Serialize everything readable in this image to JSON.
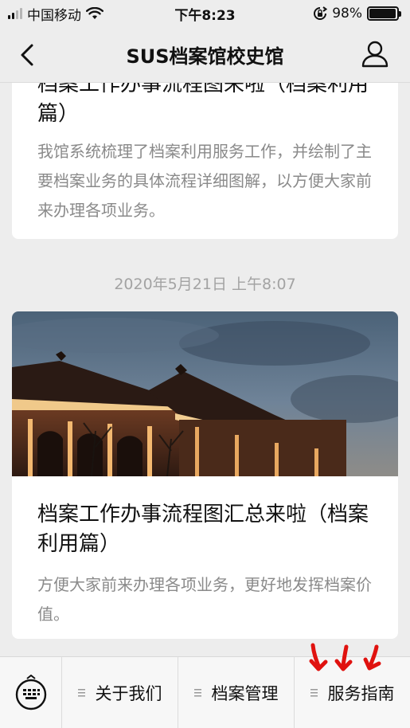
{
  "status_bar": {
    "carrier": "中国移动",
    "time": "下午8:23",
    "battery": "98%",
    "battery_level": 0.98
  },
  "nav": {
    "title": "SUS档案馆校史馆"
  },
  "feed": {
    "article1": {
      "title": "档案工作办事流程图来啦（档案利用篇）",
      "description": "我馆系统梳理了档案利用服务工作，并绘制了主要档案业务的具体流程详细图解，以方便大家前来办理各项业务。"
    },
    "timestamp": "2020年5月21日 上午8:07",
    "article2": {
      "title": "档案工作办事流程图汇总来啦（档案利用篇）",
      "description": "方便大家前来办理各项业务，更好地发挥档案价值。"
    }
  },
  "menu": {
    "items": [
      {
        "label": "关于我们"
      },
      {
        "label": "档案管理"
      },
      {
        "label": "服务指南"
      }
    ]
  },
  "colors": {
    "annotation_arrows": "#e0120f"
  }
}
